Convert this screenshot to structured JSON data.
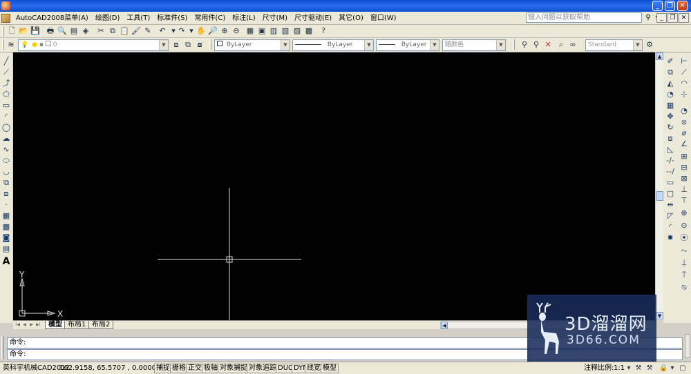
{
  "title_bar": {
    "controls": [
      "minimize",
      "restore",
      "close"
    ]
  },
  "menu": {
    "items": [
      "AutoCAD2008菜单(A)",
      "绘图(D)",
      "工具(T)",
      "标准件(S)",
      "常用件(C)",
      "标注(L)",
      "尺寸(M)",
      "尺寸驱动(E)",
      "其它(O)",
      "窗口(W)"
    ],
    "help_search_placeholder": "键入问题以获取帮助"
  },
  "toolbar_properties": {
    "layer_value": "0",
    "color_value": "ByLayer",
    "linetype_value": "ByLayer",
    "lineweight_value": "ByLayer",
    "plotstyle_value": "随颜色",
    "textstyle_value": "Standard"
  },
  "ucs": {
    "x_label": "X",
    "y_label": "Y"
  },
  "layout_tabs": [
    "模型",
    "布局1",
    "布局2"
  ],
  "command_lines": [
    "命令:",
    "命令:"
  ],
  "status_bar": {
    "app_name": "英科宇机械CAD2012",
    "coordinates": "162.9158, 65.5707 , 0.0000",
    "toggles": [
      "捕捉",
      "栅格",
      "正交",
      "极轴",
      "对象捕捉",
      "对象追踪",
      "DUCS",
      "DYN",
      "线宽",
      "模型"
    ],
    "annotation_scale_label": "注释比例:",
    "annotation_scale_value": "1:1"
  },
  "watermark": {
    "main": "3D溜溜网",
    "sub": "3D66.COM"
  },
  "colors": {
    "canvas_bg": "#000000",
    "crosshair": "#ffffff",
    "title_bar": "#0a4fd1",
    "chrome_bg": "#ece9d8"
  }
}
